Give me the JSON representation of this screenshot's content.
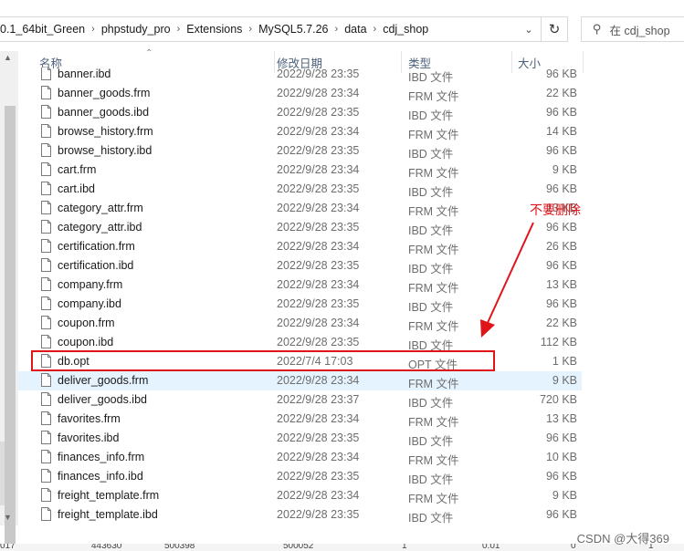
{
  "address": {
    "crumbs": [
      "0.1_64bit_Green",
      "phpstudy_pro",
      "Extensions",
      "MySQL5.7.26",
      "data",
      "cdj_shop"
    ],
    "separator": "›",
    "dropdown": "⌄",
    "refresh": "↻",
    "search_placeholder": "在 cdj_shop"
  },
  "header": {
    "name": "名称",
    "date": "修改日期",
    "type": "类型",
    "size": "大小"
  },
  "rows": [
    {
      "name": "banner.ibd",
      "date": "2022/9/28 23:35",
      "type": "IBD 文件",
      "size": "96 KB"
    },
    {
      "name": "banner_goods.frm",
      "date": "2022/9/28 23:34",
      "type": "FRM 文件",
      "size": "22 KB"
    },
    {
      "name": "banner_goods.ibd",
      "date": "2022/9/28 23:35",
      "type": "IBD 文件",
      "size": "96 KB"
    },
    {
      "name": "browse_history.frm",
      "date": "2022/9/28 23:34",
      "type": "FRM 文件",
      "size": "14 KB"
    },
    {
      "name": "browse_history.ibd",
      "date": "2022/9/28 23:35",
      "type": "IBD 文件",
      "size": "96 KB"
    },
    {
      "name": "cart.frm",
      "date": "2022/9/28 23:34",
      "type": "FRM 文件",
      "size": "9 KB"
    },
    {
      "name": "cart.ibd",
      "date": "2022/9/28 23:35",
      "type": "IBD 文件",
      "size": "96 KB"
    },
    {
      "name": "category_attr.frm",
      "date": "2022/9/28 23:34",
      "type": "FRM 文件",
      "size": "13 KB"
    },
    {
      "name": "category_attr.ibd",
      "date": "2022/9/28 23:35",
      "type": "IBD 文件",
      "size": "96 KB"
    },
    {
      "name": "certification.frm",
      "date": "2022/9/28 23:34",
      "type": "FRM 文件",
      "size": "26 KB"
    },
    {
      "name": "certification.ibd",
      "date": "2022/9/28 23:35",
      "type": "IBD 文件",
      "size": "96 KB"
    },
    {
      "name": "company.frm",
      "date": "2022/9/28 23:34",
      "type": "FRM 文件",
      "size": "13 KB"
    },
    {
      "name": "company.ibd",
      "date": "2022/9/28 23:35",
      "type": "IBD 文件",
      "size": "96 KB"
    },
    {
      "name": "coupon.frm",
      "date": "2022/9/28 23:34",
      "type": "FRM 文件",
      "size": "22 KB"
    },
    {
      "name": "coupon.ibd",
      "date": "2022/9/28 23:35",
      "type": "IBD 文件",
      "size": "112 KB"
    },
    {
      "name": "db.opt",
      "date": "2022/7/4 17:03",
      "type": "OPT 文件",
      "size": "1 KB"
    },
    {
      "name": "deliver_goods.frm",
      "date": "2022/9/28 23:34",
      "type": "FRM 文件",
      "size": "9 KB",
      "selected": true
    },
    {
      "name": "deliver_goods.ibd",
      "date": "2022/9/28 23:37",
      "type": "IBD 文件",
      "size": "720 KB"
    },
    {
      "name": "favorites.frm",
      "date": "2022/9/28 23:34",
      "type": "FRM 文件",
      "size": "13 KB"
    },
    {
      "name": "favorites.ibd",
      "date": "2022/9/28 23:35",
      "type": "IBD 文件",
      "size": "96 KB"
    },
    {
      "name": "finances_info.frm",
      "date": "2022/9/28 23:34",
      "type": "FRM 文件",
      "size": "10 KB"
    },
    {
      "name": "finances_info.ibd",
      "date": "2022/9/28 23:35",
      "type": "IBD 文件",
      "size": "96 KB"
    },
    {
      "name": "freight_template.frm",
      "date": "2022/9/28 23:34",
      "type": "FRM 文件",
      "size": "9 KB"
    },
    {
      "name": "freight_template.ibd",
      "date": "2022/9/28 23:35",
      "type": "IBD 文件",
      "size": "96 KB"
    }
  ],
  "annotation": {
    "text": "不要删除",
    "color": "#e0151b"
  },
  "watermark": "CSDN @大得369",
  "bottom_numbers": [
    "017",
    "443630",
    "500398",
    "500052",
    "1",
    "0.01",
    "0",
    "1"
  ]
}
